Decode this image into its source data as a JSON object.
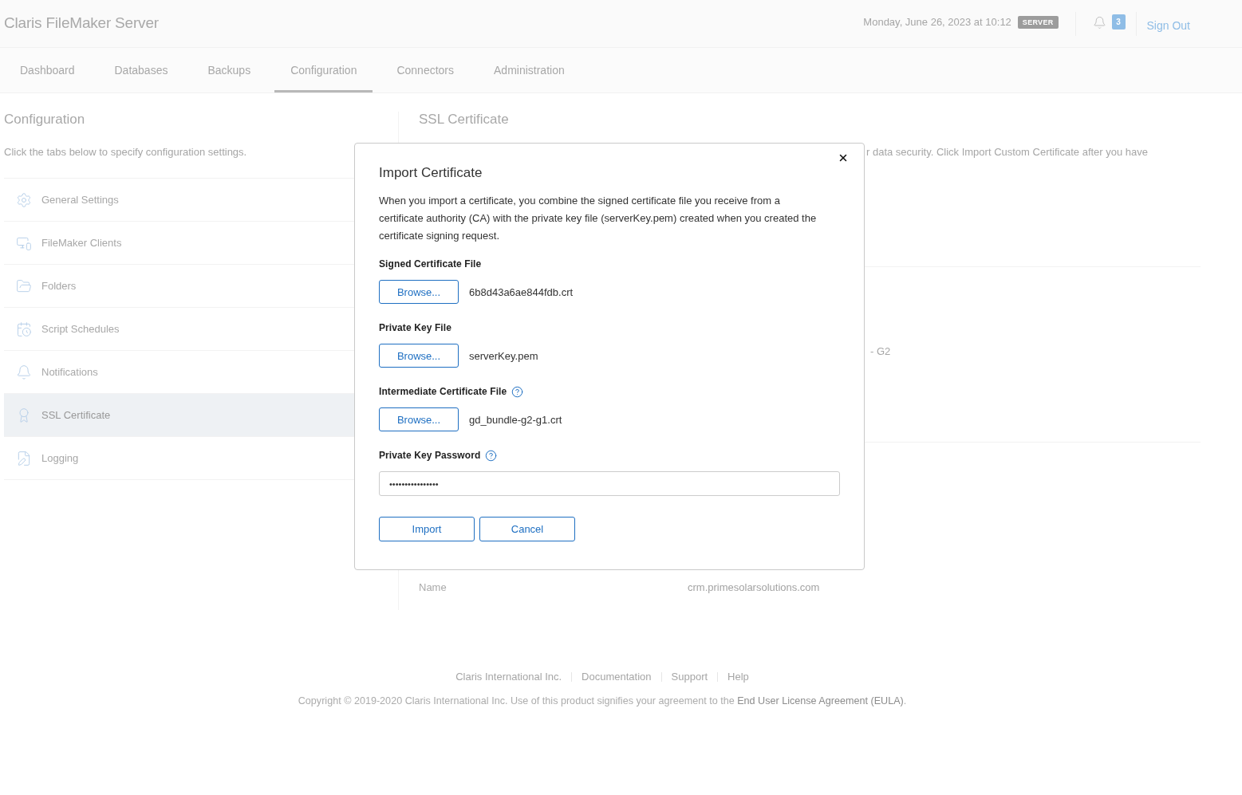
{
  "header": {
    "logo": "Claris FileMaker Server",
    "datetime": "Monday, June 26, 2023 at 10:12",
    "server_badge": "SERVER",
    "notification_count": "3",
    "sign_out": "Sign Out"
  },
  "tabs": [
    {
      "label": "Dashboard",
      "selected": false
    },
    {
      "label": "Databases",
      "selected": false
    },
    {
      "label": "Backups",
      "selected": false
    },
    {
      "label": "Configuration",
      "selected": true
    },
    {
      "label": "Connectors",
      "selected": false
    },
    {
      "label": "Administration",
      "selected": false
    }
  ],
  "sidebar": {
    "title": "Configuration",
    "description": "Click the tabs below to specify configuration settings.",
    "items": [
      {
        "label": "General Settings",
        "selected": false
      },
      {
        "label": "FileMaker Clients",
        "selected": false
      },
      {
        "label": "Folders",
        "selected": false
      },
      {
        "label": "Script Schedules",
        "selected": false
      },
      {
        "label": "Notifications",
        "selected": false
      },
      {
        "label": "SSL Certificate",
        "selected": true
      },
      {
        "label": "Logging",
        "selected": false
      }
    ]
  },
  "content": {
    "title": "SSL Certificate",
    "description": "r data security. Click Import Custom Certificate after you have",
    "issuer": "- G2",
    "rows": [
      {
        "label": "Name",
        "value": "crm.primesolarsolutions.com"
      }
    ]
  },
  "dialog": {
    "title": "Import Certificate",
    "intro": "When you import a certificate, you combine the signed certificate file you receive from a certificate authority (CA) with the private key file (serverKey.pem) created when you created the certificate signing request.",
    "fields": [
      {
        "kind": "file",
        "label": "Signed Certificate File",
        "help": false,
        "button": "Browse...",
        "file_name": "6b8d43a6ae844fdb.crt"
      },
      {
        "kind": "file",
        "label": "Private Key File",
        "help": false,
        "button": "Browse...",
        "file_name": "serverKey.pem"
      },
      {
        "kind": "file",
        "label": "Intermediate Certificate File",
        "help": true,
        "button": "Browse...",
        "file_name": "gd_bundle-g2-g1.crt"
      },
      {
        "kind": "password",
        "label": "Private Key Password",
        "help": true,
        "value": "••••••••••••••••"
      }
    ],
    "buttons": [
      "Import",
      "Cancel"
    ]
  },
  "footer": {
    "links": [
      "Claris International Inc.",
      "Documentation",
      "Support",
      "Help"
    ],
    "copyright": "Copyright © 2019-2020 Claris International Inc. Use of this product signifies your agreement to the",
    "eula_link": "End User License Agreement (EULA)",
    "copyright_end": "."
  }
}
